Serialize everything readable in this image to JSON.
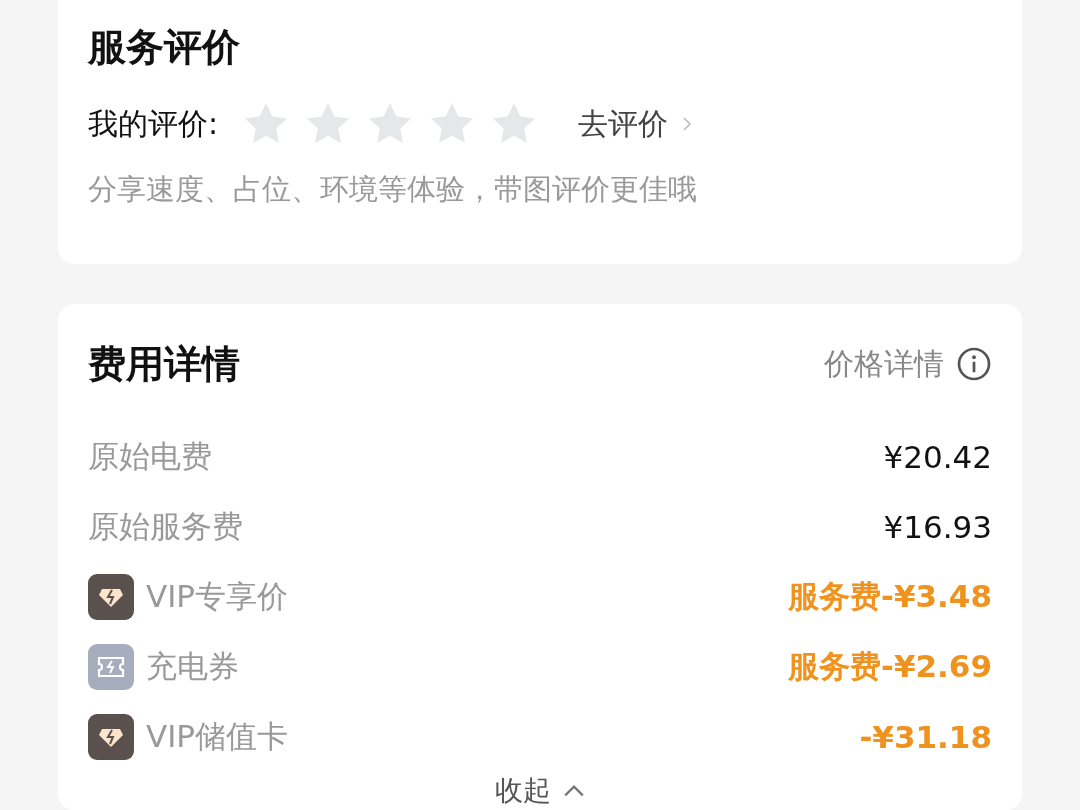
{
  "review": {
    "title": "服务评价",
    "label": "我的评价:",
    "stars": 0,
    "action": "去评价",
    "hint": "分享速度、占位、环境等体验，带图评价更佳哦"
  },
  "fees": {
    "title": "费用详情",
    "price_link": "价格详情",
    "rows": [
      {
        "kind": "plain",
        "label": "原始电费",
        "amount": "¥20.42"
      },
      {
        "kind": "plain",
        "label": "原始服务费",
        "amount": "¥16.93"
      },
      {
        "kind": "vip",
        "label": "VIP专享价",
        "amount": "服务费-¥3.48"
      },
      {
        "kind": "coupon",
        "label": "充电券",
        "amount": "服务费-¥2.69"
      },
      {
        "kind": "vip",
        "label": "VIP储值卡",
        "amount": "-¥31.18"
      }
    ],
    "collapse": "收起"
  }
}
